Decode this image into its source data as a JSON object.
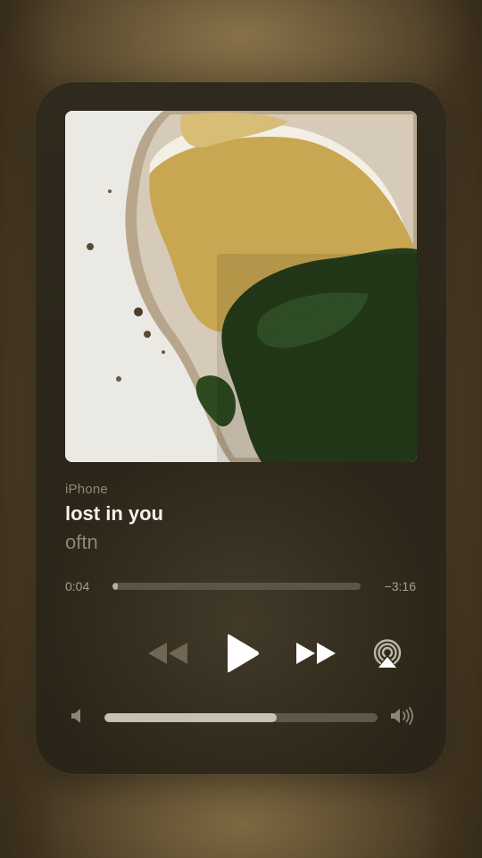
{
  "now_playing": {
    "source": "iPhone",
    "title": "lost in you",
    "artist": "oftn",
    "artwork_icon": "toast-artwork"
  },
  "progress": {
    "elapsed": "0:04",
    "remaining": "−3:16",
    "fraction": 0.02
  },
  "controls": {
    "rewind_icon": "rewind-icon",
    "play_icon": "play-icon",
    "forward_icon": "fast-forward-icon",
    "airplay_icon": "airplay-icon"
  },
  "volume": {
    "low_icon": "volume-low-icon",
    "high_icon": "volume-high-icon",
    "fraction": 0.63
  },
  "colors": {
    "card": "#2b2619",
    "title": "#f4f1ea",
    "secondary": "#8d8676",
    "track": "#5c5445",
    "fill": "#b7b0a0"
  }
}
